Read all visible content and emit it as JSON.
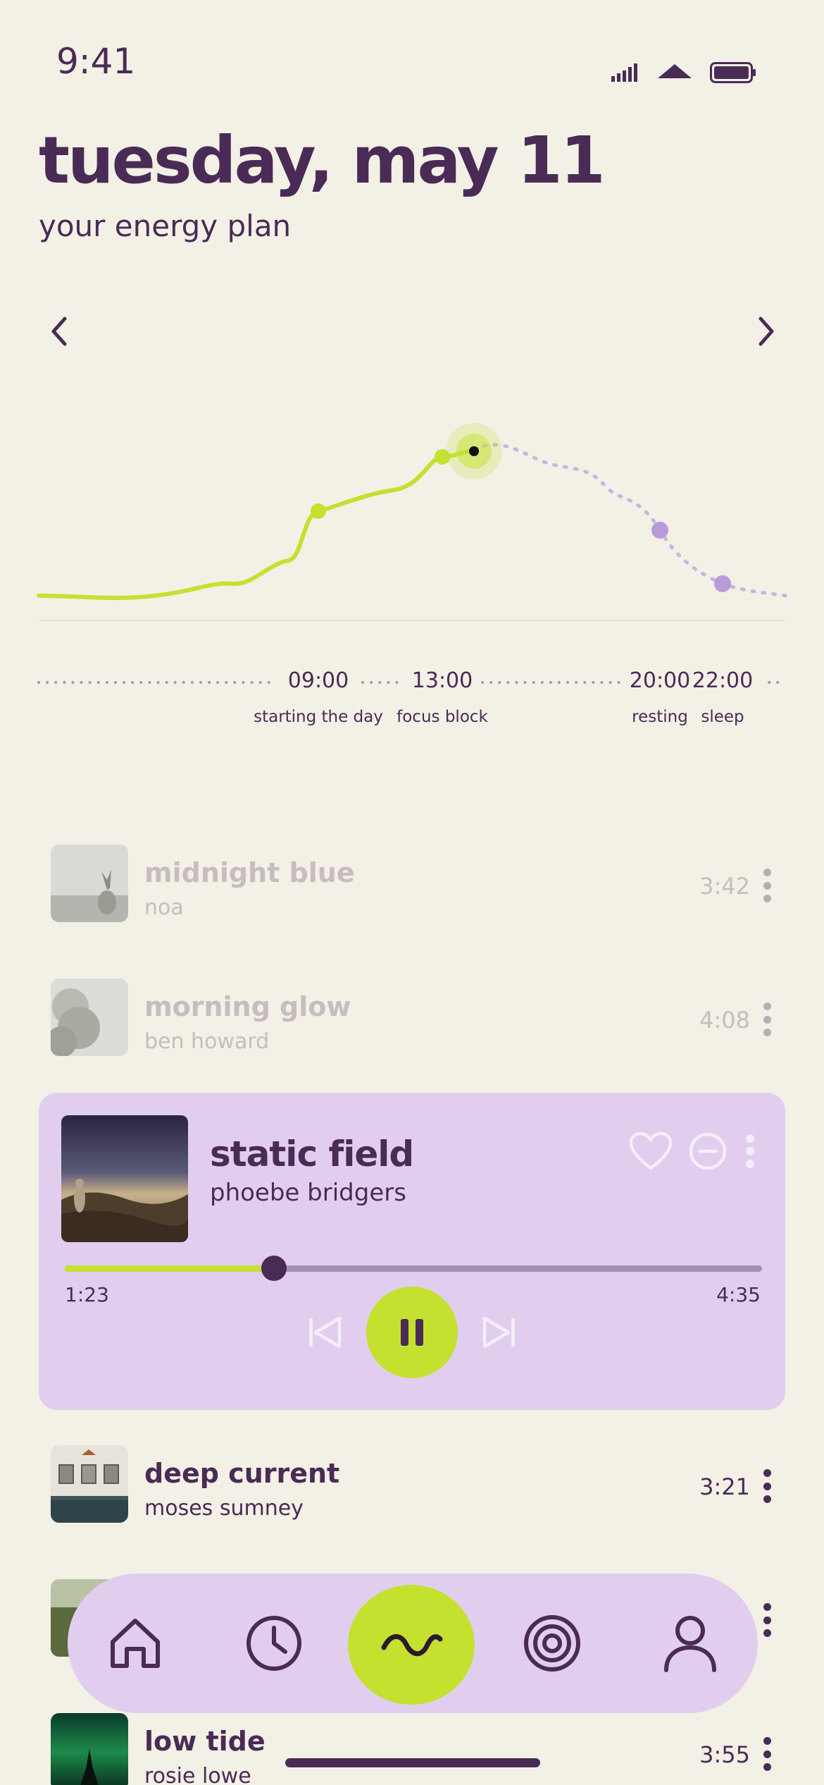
{
  "status_bar": {
    "time": "9:41"
  },
  "header": {
    "title": "tuesday, may 11",
    "subtitle": "your energy plan"
  },
  "energy_curve": {
    "points": [
      {
        "time": "09:00",
        "label": "starting the day"
      },
      {
        "time": "13:00",
        "label": "focus block"
      },
      {
        "time": "20:00",
        "label": "resting"
      },
      {
        "time": "22:00",
        "label": "sleep"
      }
    ]
  },
  "tracks_above": [
    {
      "title": "midnight blue",
      "artist": "noa",
      "duration": "3:42"
    },
    {
      "title": "morning glow",
      "artist": "ben howard",
      "duration": "4:08"
    }
  ],
  "now_playing": {
    "title": "static field",
    "artist": "phoebe bridgers",
    "elapsed": "1:23",
    "total": "4:35",
    "progress_fraction": 0.3
  },
  "tracks_below": [
    {
      "title": "deep current",
      "artist": "moses sumney",
      "duration": "3:21"
    },
    {
      "title": "low tide",
      "artist": "rosie lowe",
      "duration": "3:55"
    }
  ],
  "bottom_nav": {
    "items": [
      "home-icon",
      "clock-icon",
      "wave-icon",
      "target-icon",
      "profile-icon"
    ],
    "active": "wave-icon"
  },
  "colors": {
    "background": "#f3f0e6",
    "accent": "#c4e12f",
    "primary": "#4a2b55",
    "card": "#e1ceef",
    "future": "#b89bd8"
  }
}
